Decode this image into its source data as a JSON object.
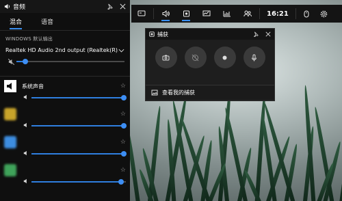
{
  "audio": {
    "title": "音频",
    "tabs": [
      "混合",
      "语音"
    ],
    "section_label": "WINDOWS 默认输出",
    "device": "Realtek HD Audio 2nd output (Realtek(R)...",
    "master_level": 0.08,
    "apps": [
      {
        "name": "系统声音",
        "level": 0.98,
        "color": "#ffffff"
      },
      {
        "name": "",
        "level": 0.98,
        "color": "#c8a42a"
      },
      {
        "name": "",
        "level": 0.98,
        "color": "#3d8de0"
      },
      {
        "name": "",
        "level": 0.95,
        "color": "#3fa35a"
      }
    ]
  },
  "gamebar": {
    "time": "16:21",
    "icons": [
      "widgets-icon",
      "audio-icon",
      "capture-icon",
      "performance-icon",
      "resources-icon",
      "social-icon",
      "mouse-icon",
      "settings-icon"
    ]
  },
  "capture": {
    "title": "捕获",
    "footer": "查看我的捕获",
    "buttons": [
      "screenshot-icon",
      "record-last-icon",
      "record-icon",
      "mic-icon"
    ]
  }
}
